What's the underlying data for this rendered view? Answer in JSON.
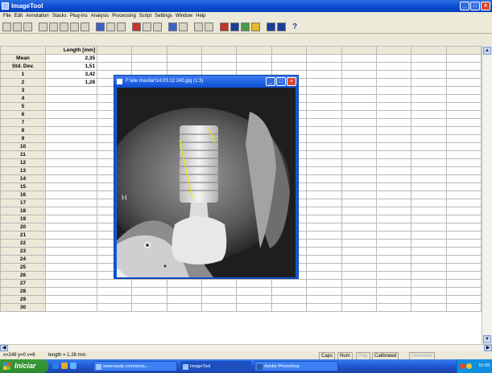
{
  "app": {
    "title": "ImageTool"
  },
  "menu": [
    "File",
    "Edit",
    "Annotation",
    "Stacks",
    "Plug-Ins",
    "Analysis",
    "Processing",
    "Script",
    "Settings",
    "Window",
    "Help"
  ],
  "toolbar": {
    "help_glyph": "?"
  },
  "table": {
    "column_header": "Length [mm]",
    "summary_rows": [
      {
        "label": "Mean",
        "value": "2,35"
      },
      {
        "label": "Std. Dev.",
        "value": "1,51"
      }
    ],
    "data_rows": [
      {
        "label": "1",
        "value": "3,42"
      },
      {
        "label": "2",
        "value": "1,28"
      },
      {
        "label": "3",
        "value": ""
      },
      {
        "label": "4",
        "value": ""
      },
      {
        "label": "5",
        "value": ""
      },
      {
        "label": "6",
        "value": ""
      },
      {
        "label": "7",
        "value": ""
      },
      {
        "label": "8",
        "value": ""
      },
      {
        "label": "9",
        "value": ""
      },
      {
        "label": "10",
        "value": ""
      },
      {
        "label": "11",
        "value": ""
      },
      {
        "label": "12",
        "value": ""
      },
      {
        "label": "13",
        "value": ""
      },
      {
        "label": "14",
        "value": ""
      },
      {
        "label": "15",
        "value": ""
      },
      {
        "label": "16",
        "value": ""
      },
      {
        "label": "17",
        "value": ""
      },
      {
        "label": "18",
        "value": ""
      },
      {
        "label": "19",
        "value": ""
      },
      {
        "label": "20",
        "value": ""
      },
      {
        "label": "21",
        "value": ""
      },
      {
        "label": "22",
        "value": ""
      },
      {
        "label": "23",
        "value": ""
      },
      {
        "label": "24",
        "value": ""
      },
      {
        "label": "25",
        "value": ""
      },
      {
        "label": "26",
        "value": ""
      },
      {
        "label": "27",
        "value": ""
      },
      {
        "label": "28",
        "value": ""
      },
      {
        "label": "29",
        "value": ""
      },
      {
        "label": "30",
        "value": ""
      }
    ]
  },
  "image_window": {
    "title": "F:\\ele maxilar\\14.03.12 240.jpg (1:3)",
    "marker_glyph": "H"
  },
  "status": {
    "coords": "x=249 y=0 v=6",
    "length": "length = 1.28 mm",
    "indicators": [
      {
        "label": "Caps",
        "active": true
      },
      {
        "label": "Num",
        "active": true
      },
      {
        "label": "Play",
        "active": false
      },
      {
        "label": "Calibrated",
        "active": true
      },
      {
        "label": "Overwrite",
        "active": false
      }
    ]
  },
  "taskbar": {
    "start_label": "Iniciar",
    "tasks": [
      {
        "label": "www.lasak.com/stora..."
      },
      {
        "label": "ImageTool"
      },
      {
        "label": "Adobe Photoshop"
      }
    ],
    "clock": "10:09"
  }
}
